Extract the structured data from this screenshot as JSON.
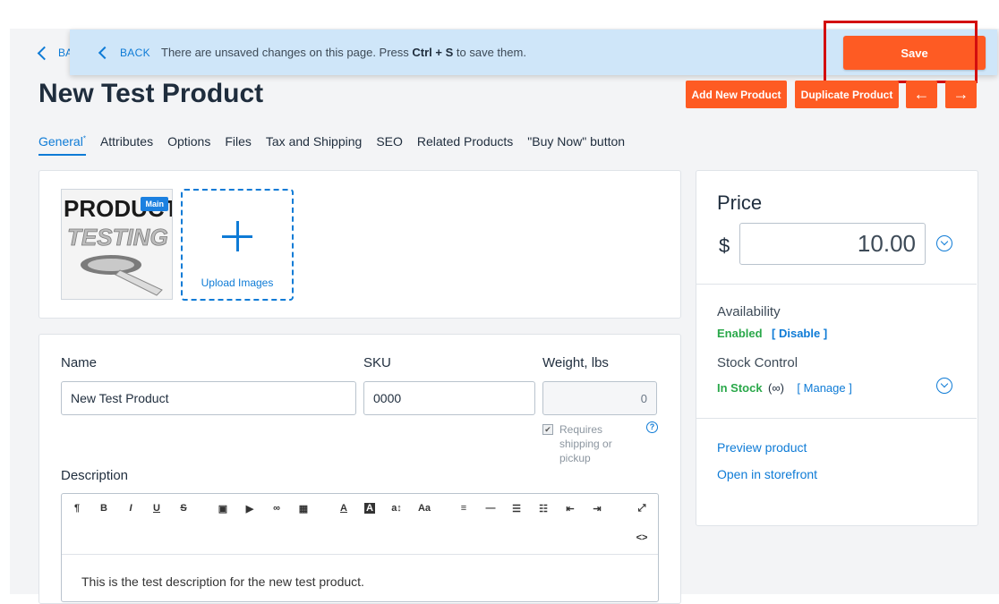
{
  "background_back": {
    "label": "BA"
  },
  "banner": {
    "back_label": "BACK",
    "message_pre": "There are unsaved changes on this page. Press ",
    "message_key": "Ctrl + S",
    "message_post": " to save them.",
    "save_label": "Save"
  },
  "header": {
    "title": "New Test Product",
    "add_new_label": "Add New Product",
    "duplicate_label": "Duplicate Product",
    "prev_arrow": "←",
    "next_arrow": "→"
  },
  "tabs": [
    {
      "label": "General",
      "marker": "*"
    },
    {
      "label": "Attributes"
    },
    {
      "label": "Options"
    },
    {
      "label": "Files"
    },
    {
      "label": "Tax and Shipping"
    },
    {
      "label": "SEO"
    },
    {
      "label": "Related Products"
    },
    {
      "label": "\"Buy Now\" button"
    }
  ],
  "images": {
    "main_badge": "Main",
    "upload_label": "Upload Images",
    "thumb_text_1": "PRODUCT",
    "thumb_text_2": "TESTING"
  },
  "form": {
    "name_label": "Name",
    "name_value": "New Test Product",
    "sku_label": "SKU",
    "sku_value": "0000",
    "weight_label": "Weight, lbs",
    "weight_value": "0",
    "requires_shipping": "Requires shipping or pickup",
    "help_icon": "?",
    "description_label": "Description",
    "description_text": "This is the test description for the new test product."
  },
  "price": {
    "title": "Price",
    "currency": "$",
    "value": "10.00"
  },
  "availability": {
    "label": "Availability",
    "status": "Enabled",
    "action": "[ Disable ]"
  },
  "stock": {
    "label": "Stock Control",
    "status": "In Stock",
    "infinity": "(∞)",
    "action": "[ Manage ]"
  },
  "links": {
    "preview": "Preview product",
    "storefront": "Open in storefront"
  },
  "colors": {
    "accent": "#fe5b23",
    "link": "#0e7bd6",
    "banner": "#cfe6f9",
    "highlight": "#d30e0e",
    "success": "#2aa84a"
  }
}
